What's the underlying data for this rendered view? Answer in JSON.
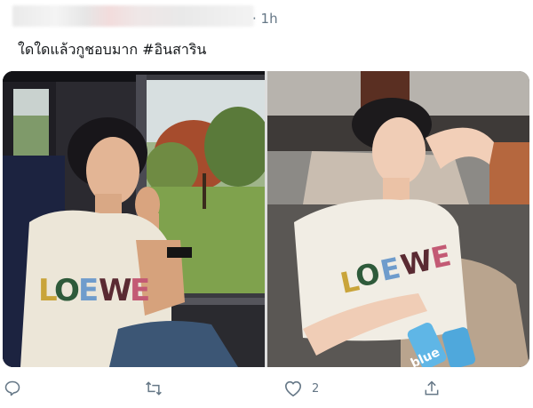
{
  "header": {
    "timestamp": "· 1h"
  },
  "tweet": {
    "text": "ใดใดแล้วกูชอบมาก #อินสาริน"
  },
  "media": {
    "photos": [
      {
        "shirt_text": "LOEWE"
      },
      {
        "shirt_text": "LOEWE"
      }
    ],
    "bottle_text": "blue"
  },
  "actions": {
    "like_count": "2",
    "icons": [
      "reply-icon",
      "retweet-icon",
      "like-icon",
      "share-icon"
    ]
  },
  "colors": {
    "text": "#14171a",
    "muted": "#657786"
  }
}
